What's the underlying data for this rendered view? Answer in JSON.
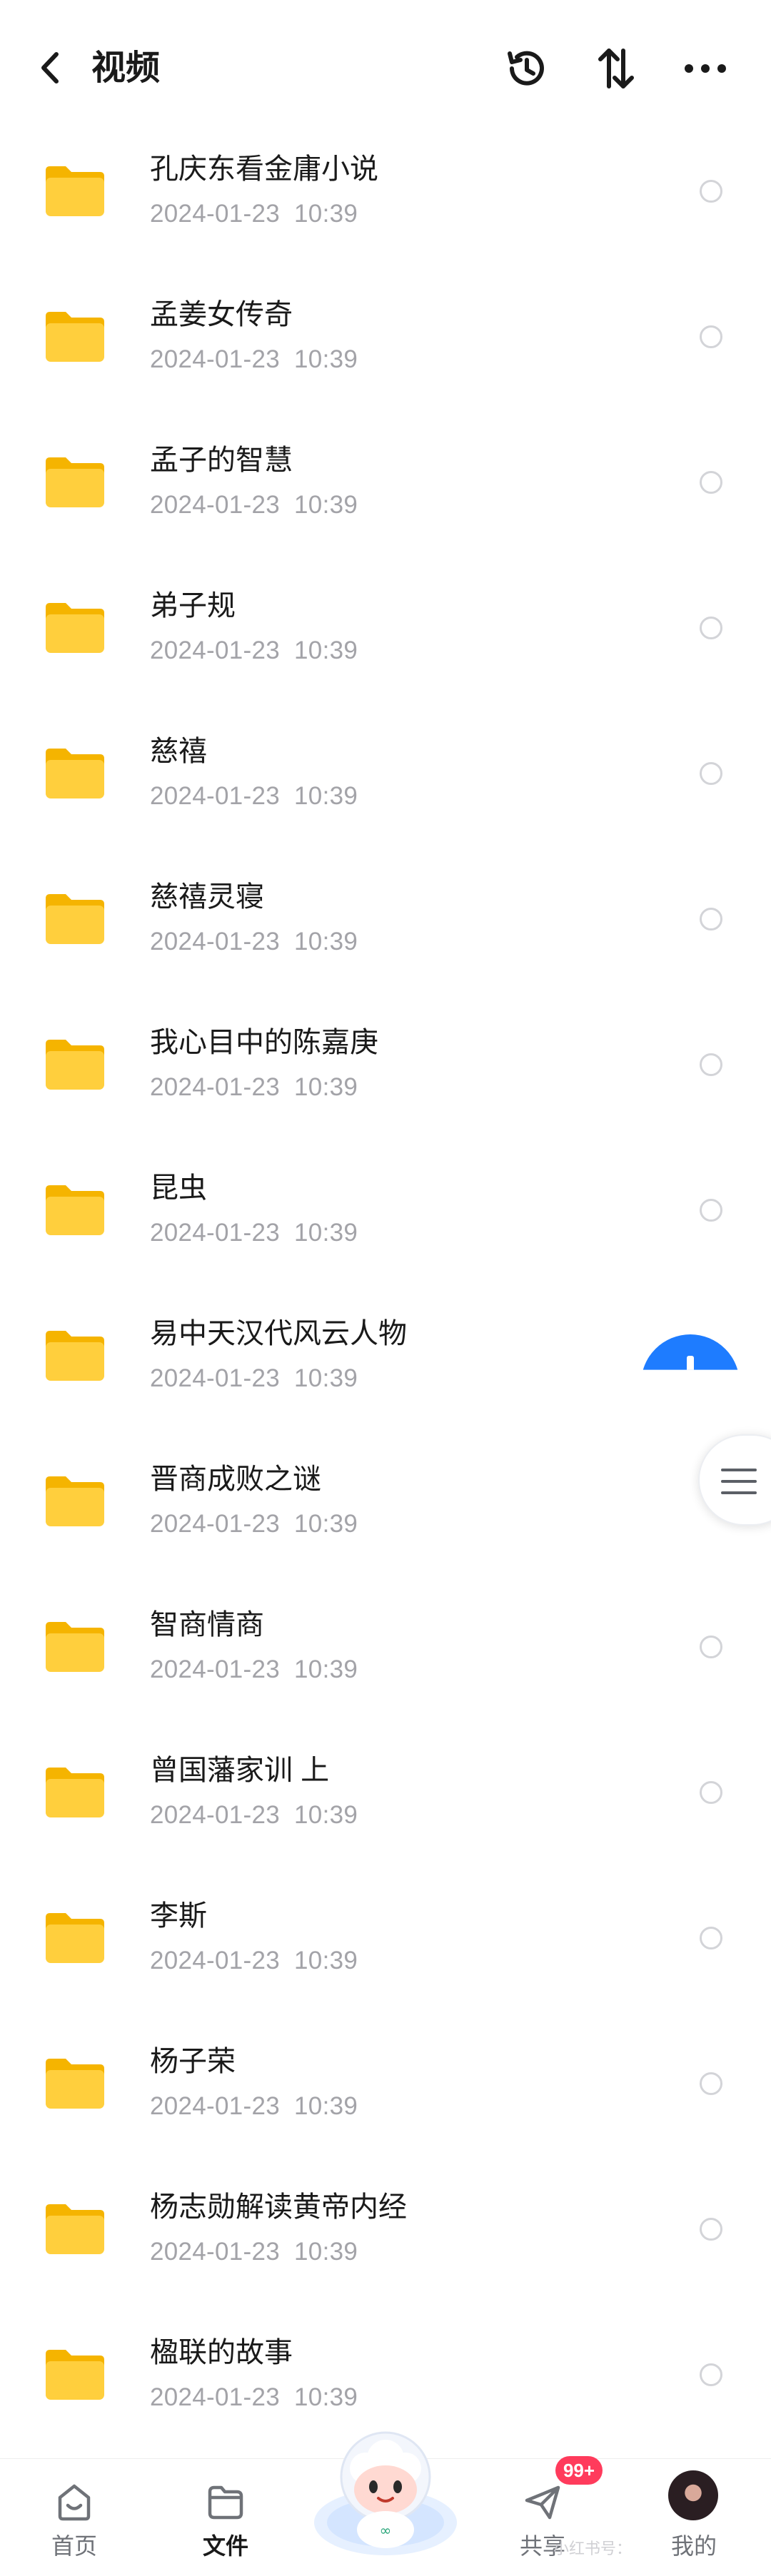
{
  "header": {
    "title": "视频",
    "back_icon": "chevron-left-icon",
    "actions": [
      "history-icon",
      "sort-icon",
      "more-icon"
    ]
  },
  "folders": [
    {
      "name": "孔庆东看金庸小说",
      "date": "2024-01-23",
      "time": "10:39"
    },
    {
      "name": "孟姜女传奇",
      "date": "2024-01-23",
      "time": "10:39"
    },
    {
      "name": "孟子的智慧",
      "date": "2024-01-23",
      "time": "10:39"
    },
    {
      "name": "弟子规",
      "date": "2024-01-23",
      "time": "10:39"
    },
    {
      "name": "慈禧",
      "date": "2024-01-23",
      "time": "10:39"
    },
    {
      "name": "慈禧灵寝",
      "date": "2024-01-23",
      "time": "10:39"
    },
    {
      "name": "我心目中的陈嘉庚",
      "date": "2024-01-23",
      "time": "10:39"
    },
    {
      "name": "昆虫",
      "date": "2024-01-23",
      "time": "10:39"
    },
    {
      "name": "易中天汉代风云人物",
      "date": "2024-01-23",
      "time": "10:39"
    },
    {
      "name": "晋商成败之谜",
      "date": "2024-01-23",
      "time": "10:39"
    },
    {
      "name": "智商情商",
      "date": "2024-01-23",
      "time": "10:39"
    },
    {
      "name": "曾国藩家训 上",
      "date": "2024-01-23",
      "time": "10:39"
    },
    {
      "name": "李斯",
      "date": "2024-01-23",
      "time": "10:39"
    },
    {
      "name": "杨子荣",
      "date": "2024-01-23",
      "time": "10:39"
    },
    {
      "name": "杨志勋解读黄帝内经",
      "date": "2024-01-23",
      "time": "10:39"
    },
    {
      "name": "楹联的故事",
      "date": "2024-01-23",
      "time": "10:39"
    }
  ],
  "bottom_nav": {
    "home": "首页",
    "files": "文件",
    "share": "共享",
    "share_badge": "99+",
    "me": "我的"
  },
  "watermark": "小红书号：",
  "colors": {
    "folder": "#ffcf3d",
    "accent": "#1e7cff",
    "badge": "#ff3b5c"
  }
}
